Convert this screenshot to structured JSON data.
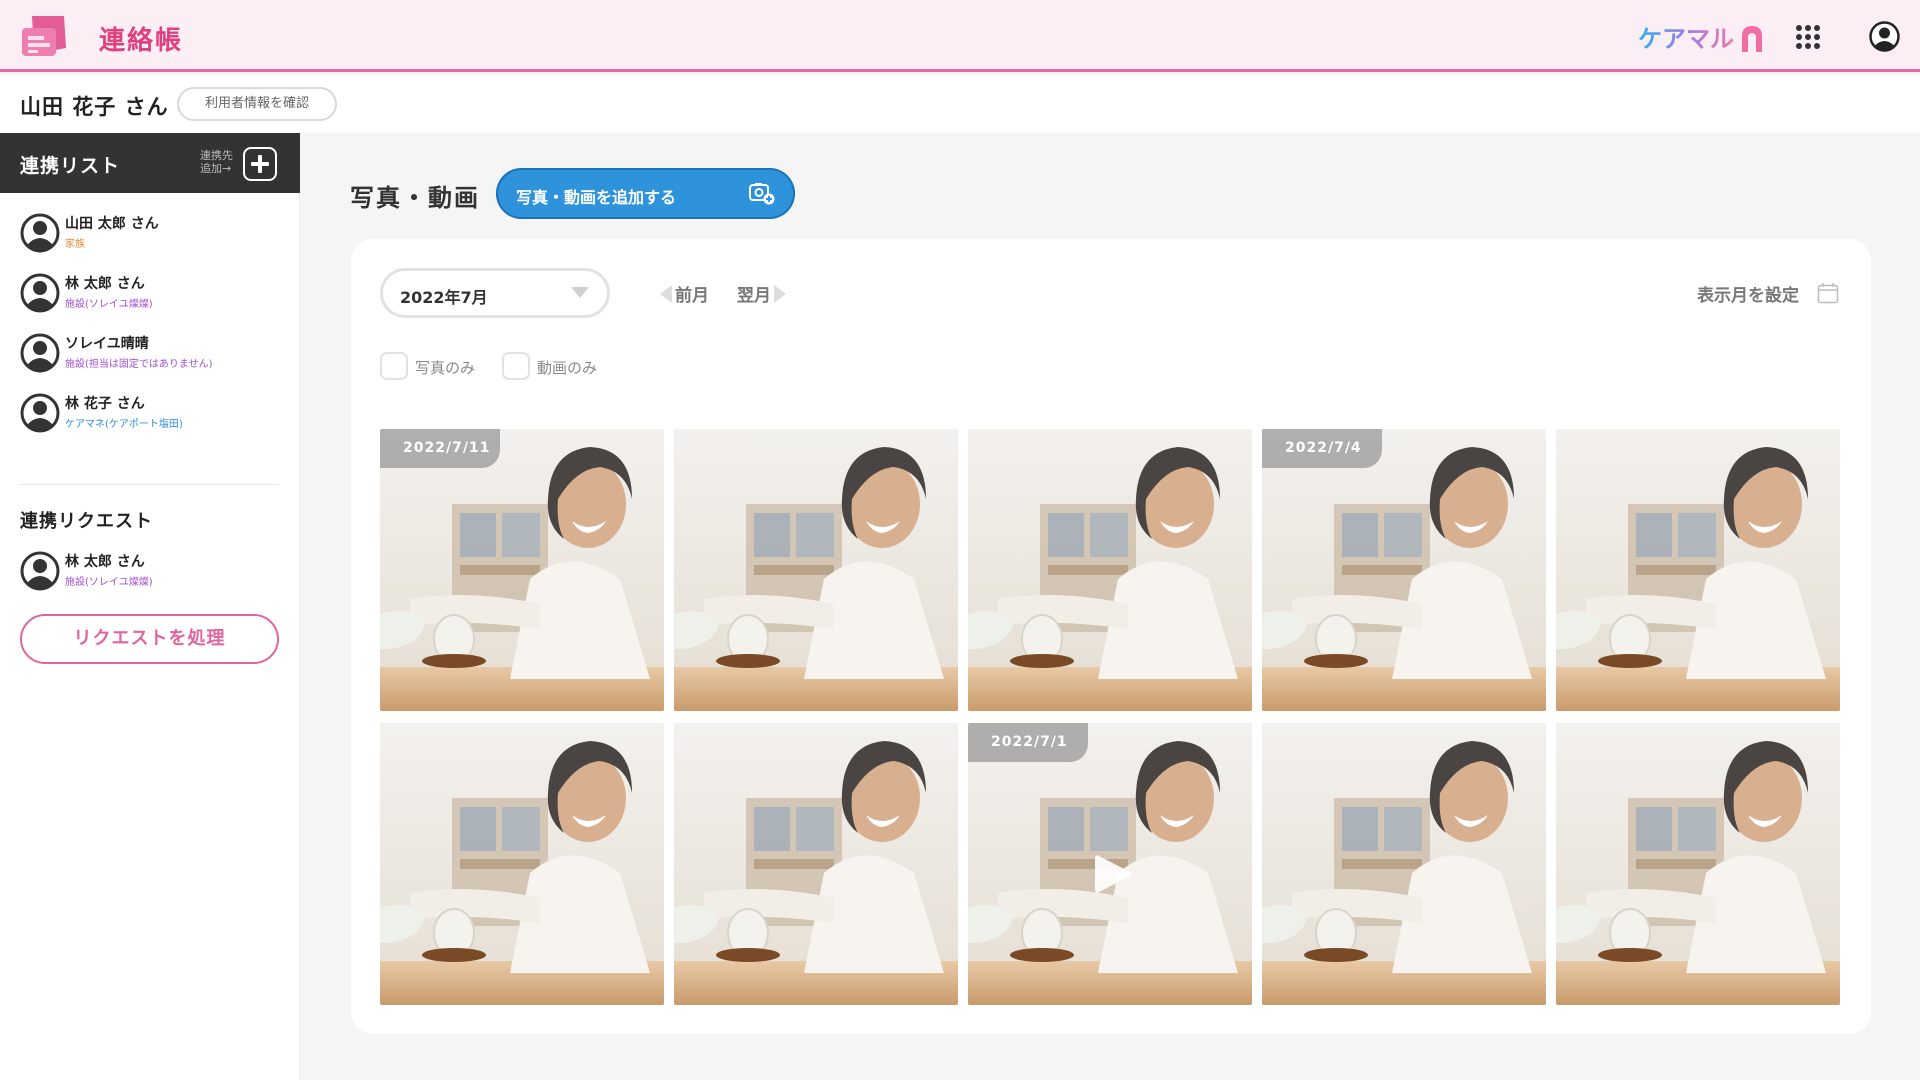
{
  "header": {
    "app_title": "連絡帳",
    "brand_text": "ケアマル"
  },
  "user": {
    "name": "山田 花子 さん",
    "info_button": "利用者情報を確認"
  },
  "sidebar": {
    "title": "連携リスト",
    "add_label": "連携先 追加→",
    "contacts": [
      {
        "name": "山田 太郎 さん",
        "role": "家族",
        "role_color": "#e78a2f"
      },
      {
        "name": "林 太郎 さん",
        "role": "施設(ソレイユ燦燦)",
        "role_color": "#a04fd0"
      },
      {
        "name": "ソレイユ晴晴",
        "role": "施設(担当は固定ではありません)",
        "role_color": "#a04fd0"
      },
      {
        "name": "林 花子 さん",
        "role": "ケアマネ(ケアポート塩田)",
        "role_color": "#2f8fd9"
      }
    ],
    "requests_title": "連携リクエスト",
    "requests": [
      {
        "name": "林 太郎 さん",
        "role": "施設(ソレイユ燦燦)",
        "role_color": "#a04fd0"
      }
    ],
    "process_button": "リクエストを処理"
  },
  "main": {
    "title": "写真・動画",
    "add_button": "写真・動画を追加する",
    "month_value": "2022年7月",
    "prev_label": "前月",
    "next_label": "翌月",
    "set_month_label": "表示月を設定",
    "filters": [
      {
        "label": "写真のみ",
        "checked": false
      },
      {
        "label": "動画のみ",
        "checked": false
      }
    ],
    "tiles": [
      {
        "date": "2022/7/11",
        "video": false
      },
      {
        "date": "",
        "video": false
      },
      {
        "date": "",
        "video": false
      },
      {
        "date": "2022/7/4",
        "video": false
      },
      {
        "date": "",
        "video": false
      },
      {
        "date": "",
        "video": false
      },
      {
        "date": "",
        "video": false
      },
      {
        "date": "2022/7/1",
        "video": true
      },
      {
        "date": "",
        "video": false
      },
      {
        "date": "",
        "video": false
      }
    ]
  },
  "colors": {
    "accent_pink": "#e0407f",
    "accent_blue": "#2f93dc",
    "header_bg": "#fbeef5",
    "sidebar_head_bg": "#333333"
  }
}
